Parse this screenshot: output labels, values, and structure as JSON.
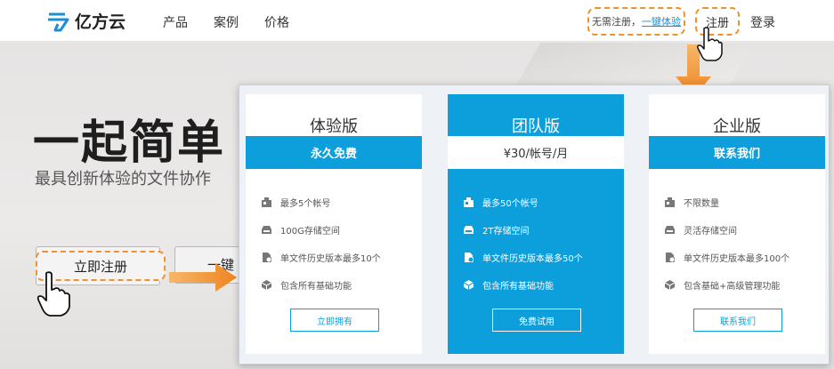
{
  "nav": {
    "logo_text": "亿方云",
    "links": [
      "产品",
      "案例",
      "价格"
    ],
    "hint_text": "无需注册，",
    "hint_link": "一键体验",
    "register": "注册",
    "login": "登录"
  },
  "hero": {
    "title": "一起简单",
    "subtitle": "最具创新体验的文件协作",
    "register_button": "立即注册",
    "second_button": "一键"
  },
  "plans": [
    {
      "name": "体验版",
      "price": "永久免费",
      "features": [
        {
          "icon": "users-icon",
          "text": "最多5个帐号"
        },
        {
          "icon": "storage-icon",
          "text": "100G存储空间"
        },
        {
          "icon": "history-icon",
          "text": "单文件历史版本最多10个"
        },
        {
          "icon": "cube-icon",
          "text": "包含所有基础功能"
        }
      ],
      "button": "立即拥有"
    },
    {
      "name": "团队版",
      "price": "¥30/帐号/月",
      "features": [
        {
          "icon": "users-icon",
          "text": "最多50个帐号"
        },
        {
          "icon": "storage-icon",
          "text": "2T存储空间"
        },
        {
          "icon": "history-icon",
          "text": "单文件历史版本最多50个"
        },
        {
          "icon": "cube-icon",
          "text": "包含所有基础功能"
        }
      ],
      "button": "免费试用"
    },
    {
      "name": "企业版",
      "price": "联系我们",
      "features": [
        {
          "icon": "users-icon",
          "text": "不限数量"
        },
        {
          "icon": "storage-icon",
          "text": "灵活存储空间"
        },
        {
          "icon": "history-icon",
          "text": "单文件历史版本最多100个"
        },
        {
          "icon": "cube-icon",
          "text": "包含基础+高级管理功能"
        }
      ],
      "button": "联系我们"
    }
  ],
  "colors": {
    "accent_blue": "#0d9fdc",
    "highlight_orange": "#f0922b"
  }
}
